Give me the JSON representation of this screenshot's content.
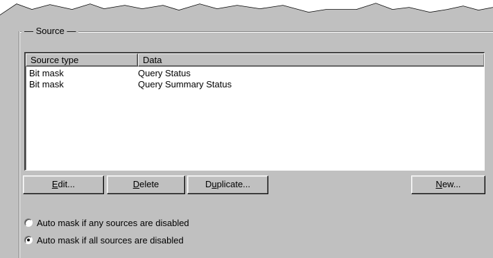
{
  "group": {
    "title": "Source"
  },
  "list": {
    "columns": [
      "Source type",
      "Data"
    ],
    "rows": [
      {
        "source_type": "Bit mask",
        "data": "Query Status"
      },
      {
        "source_type": "Bit mask",
        "data": "Query Summary Status"
      }
    ]
  },
  "buttons": {
    "edit": {
      "mnemonic": "E",
      "rest": "dit..."
    },
    "delete": {
      "mnemonic": "D",
      "rest": "elete"
    },
    "duplicate": {
      "pre": "D",
      "mnemonic": "u",
      "rest": "plicate..."
    },
    "new": {
      "mnemonic": "N",
      "rest": "ew..."
    }
  },
  "radios": [
    {
      "label": "Auto mask if any sources are disabled",
      "checked": false
    },
    {
      "label": "Auto mask if all sources are disabled",
      "checked": true
    }
  ],
  "colors": {
    "face": "#c0c0c0",
    "shadow": "#808080",
    "highlight": "#ffffff"
  }
}
